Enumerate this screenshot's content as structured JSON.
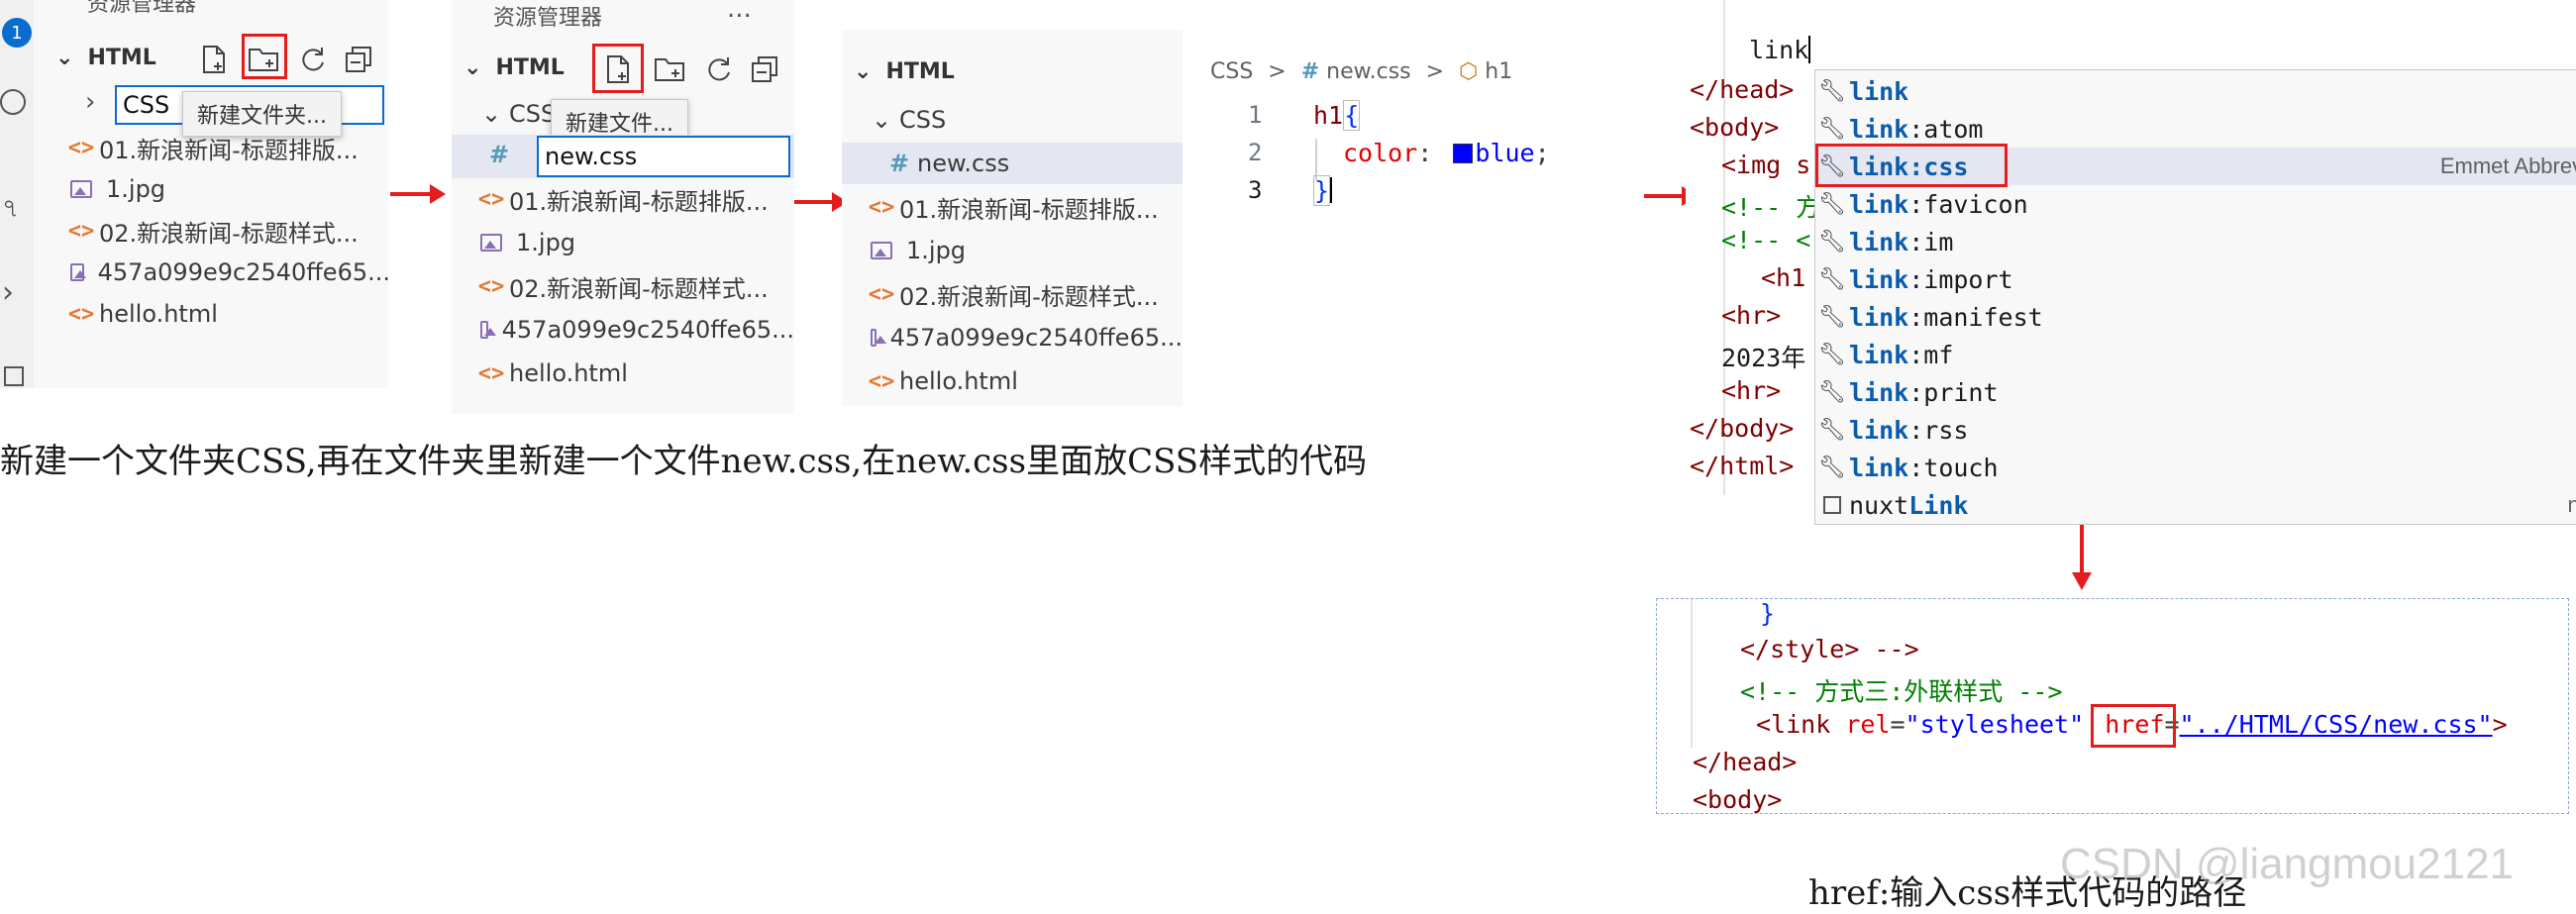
{
  "panel1": {
    "header_title": "资源管理器",
    "badge": "1",
    "section_title": "HTML",
    "tooltip": "新建文件夹...",
    "input_value": "CSS",
    "files": [
      {
        "name": "01.新浪新闻-标题排版...",
        "icon": "html-file-icon"
      },
      {
        "name": "1.jpg",
        "icon": "image-file-icon"
      },
      {
        "name": "02.新浪新闻-标题样式...",
        "icon": "html-file-icon"
      },
      {
        "name": "457a099e9c2540ffe65...",
        "icon": "image-file-icon"
      },
      {
        "name": "hello.html",
        "icon": "html-file-icon"
      }
    ]
  },
  "panel2": {
    "header_title": "资源管理器",
    "more": "...",
    "section_title": "HTML",
    "folder_name": "CSS",
    "tooltip": "新建文件...",
    "input_value": "new.css",
    "files": [
      {
        "name": "01.新浪新闻-标题排版...",
        "icon": "html-file-icon"
      },
      {
        "name": "1.jpg",
        "icon": "image-file-icon"
      },
      {
        "name": "02.新浪新闻-标题样式...",
        "icon": "html-file-icon"
      },
      {
        "name": "457a099e9c2540ffe65...",
        "icon": "image-file-icon"
      },
      {
        "name": "hello.html",
        "icon": "html-file-icon"
      }
    ]
  },
  "panel3": {
    "section_title": "HTML",
    "folder_name": "CSS",
    "selected_file": "new.css",
    "files": [
      {
        "name": "01.新浪新闻-标题排版...",
        "icon": "html-file-icon"
      },
      {
        "name": "1.jpg",
        "icon": "image-file-icon"
      },
      {
        "name": "02.新浪新闻-标题样式...",
        "icon": "html-file-icon"
      },
      {
        "name": "457a099e9c2540ffe65...",
        "icon": "image-file-icon"
      },
      {
        "name": "hello.html",
        "icon": "html-file-icon"
      }
    ]
  },
  "editor": {
    "breadcrumb": {
      "folder": "CSS",
      "file": "new.css",
      "symbol": "h1",
      "sep": ">"
    },
    "line_numbers": [
      "1",
      "2",
      "3"
    ],
    "line1_selector": "h1",
    "line1_brace": "{",
    "line2_prop": "color",
    "line2_colon": ":",
    "line2_value": "blue",
    "line2_semicolon": ";",
    "line3_brace": "}",
    "swatch_color": "#0000ff"
  },
  "html_editor": {
    "typed": "link",
    "lines": [
      "</head>",
      "<body>",
      "<img s",
      "<!-- 方",
      "<!-- <",
      "<h1",
      "<hr>",
      "2023年",
      "<hr>",
      "</body>",
      "</html>"
    ],
    "autocomplete": [
      {
        "prefix": "link",
        "rest": "",
        "icon": "wrench-icon"
      },
      {
        "prefix": "link",
        "rest": ":atom",
        "icon": "wrench-icon"
      },
      {
        "prefix": "link",
        "rest": ":css",
        "icon": "wrench-icon",
        "selected": true
      },
      {
        "prefix": "link",
        "rest": ":favicon",
        "icon": "wrench-icon"
      },
      {
        "prefix": "link",
        "rest": ":im",
        "icon": "wrench-icon"
      },
      {
        "prefix": "link",
        "rest": ":import",
        "icon": "wrench-icon"
      },
      {
        "prefix": "link",
        "rest": ":manifest",
        "icon": "wrench-icon"
      },
      {
        "prefix": "link",
        "rest": ":mf",
        "icon": "wrench-icon"
      },
      {
        "prefix": "link",
        "rest": ":print",
        "icon": "wrench-icon"
      },
      {
        "prefix": "link",
        "rest": ":rss",
        "icon": "wrench-icon"
      },
      {
        "prefix": "link",
        "rest": ":touch",
        "icon": "wrench-icon"
      },
      {
        "prefix": "nuxt",
        "rest": "Link",
        "icon": "square-icon"
      }
    ],
    "detail": "Emmet Abbrevi",
    "right_edge": "nu"
  },
  "result_code": {
    "line1": "}",
    "line2": "</style> -->",
    "line3": "<!-- 方式三:外联样式 -->",
    "line4_tag_open": "<link",
    "line4_attr1": "rel",
    "line4_val1": "\"stylesheet\"",
    "line4_attr2": "href",
    "line4_eq": "=",
    "line4_val2": "\"../HTML/CSS/new.css\"",
    "line4_close": ">",
    "line5": "</head>",
    "line6": "<body>"
  },
  "captions": {
    "left": "新建一个文件夹CSS,再在文件夹里新建一个文件new.css,在new.css里面放CSS样式的代码",
    "right": "href:输入css样式代码的路径",
    "watermark": "CSDN @liangmou2121"
  },
  "colors": {
    "accent_red": "#e51c1c",
    "focus_blue": "#0a6ccf"
  }
}
